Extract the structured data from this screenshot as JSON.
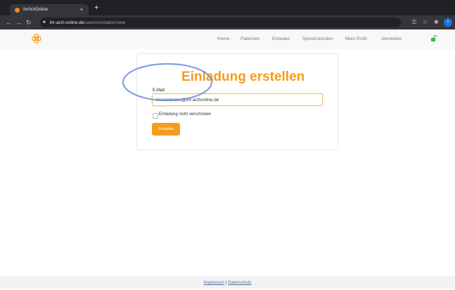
{
  "browser": {
    "tab_title": "IhrArztOnline",
    "tab_close": "×",
    "new_tab": "+",
    "url_host": "ihr-arzt-online.de",
    "url_path": "/users/invitation/new",
    "profile_initial": "i"
  },
  "nav": {
    "links": [
      "Home",
      "Patienten",
      "Einladen",
      "Sprechstunden",
      "Mein Profil",
      "Abmelden"
    ]
  },
  "form": {
    "title": "Einladung erstellen",
    "email_label": "E-Mail",
    "email_value": "mustermann@ihr-arztonline.de",
    "checkbox_label": "Einladung nicht verschicken",
    "submit_label": "Einladen"
  },
  "footer": {
    "impressum": "Impressum",
    "separator": " | ",
    "datenschutz": "Datenschutz"
  },
  "colors": {
    "accent": "#f39c1e",
    "highlight_ring": "#6f8fd8"
  }
}
